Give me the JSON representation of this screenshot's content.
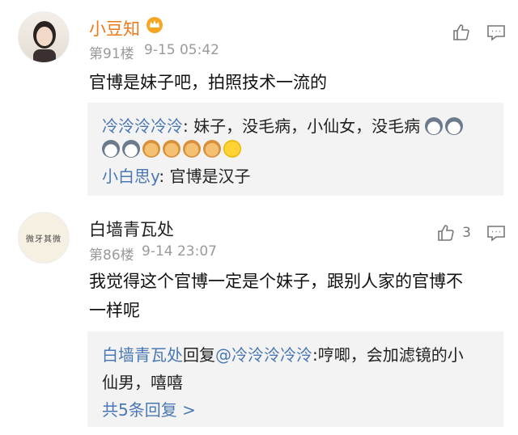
{
  "comments": [
    {
      "username": "小豆知",
      "badge_icon": "crown-icon",
      "floor": "第91楼",
      "time": "9-15 05:42",
      "text": "官博是妹子吧，拍照技术一流的",
      "like_count": "",
      "replies": [
        {
          "user": "冷泠泠冷泠",
          "text": ": 妹子，没毛病，小仙女，没毛病"
        },
        {
          "user": "小白思y",
          "text": ": 官博是汉子"
        }
      ]
    },
    {
      "username": "白墙青瓦处",
      "avatar_text": "微牙其微",
      "floor": "第86楼",
      "time": "9-14 23:07",
      "text_line1": "我觉得这个官博一定是个妹子，跟别人家的官博不",
      "text_line2": "一样呢",
      "like_count": "3",
      "replies": [
        {
          "user": "白墙青瓦处",
          "mid": "回复",
          "mention": "@冷泠泠冷泠",
          "text_line1": ":哼唧，会加滤镜的小",
          "text_line2": "仙男，嘻嘻"
        }
      ],
      "more_replies": "共5条回复 >"
    }
  ]
}
